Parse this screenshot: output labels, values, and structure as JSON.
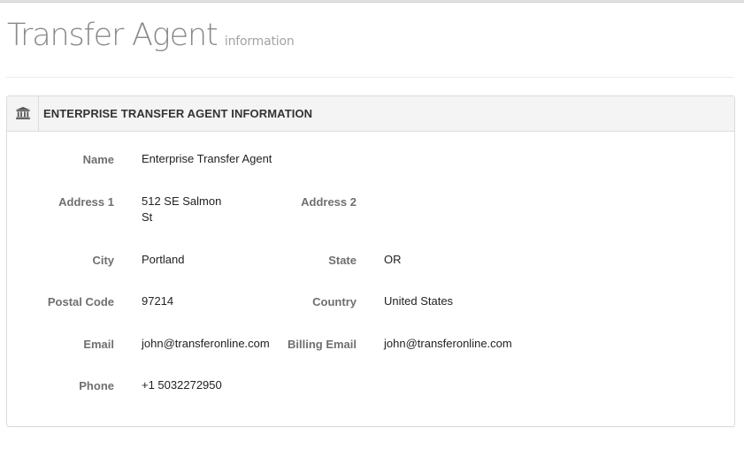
{
  "page": {
    "title": "Transfer Agent",
    "subtitle": "information"
  },
  "panel": {
    "icon": "bank-icon",
    "title": "ENTERPRISE TRANSFER AGENT INFORMATION"
  },
  "fields": {
    "name": {
      "label": "Name",
      "value": "Enterprise Transfer Agent"
    },
    "address1": {
      "label": "Address 1",
      "value_line1": "512 SE Salmon",
      "value_line2": "St"
    },
    "address2": {
      "label": "Address 2",
      "value": ""
    },
    "city": {
      "label": "City",
      "value": "Portland"
    },
    "state": {
      "label": "State",
      "value": "OR"
    },
    "postal_code": {
      "label": "Postal Code",
      "value": "97214"
    },
    "country": {
      "label": "Country",
      "value": "United States"
    },
    "email": {
      "label": "Email",
      "value": "john@transferonline.com"
    },
    "billing_email": {
      "label": "Billing Email",
      "value": "john@transferonline.com"
    },
    "phone": {
      "label": "Phone",
      "value": "+1 5032272950"
    }
  }
}
